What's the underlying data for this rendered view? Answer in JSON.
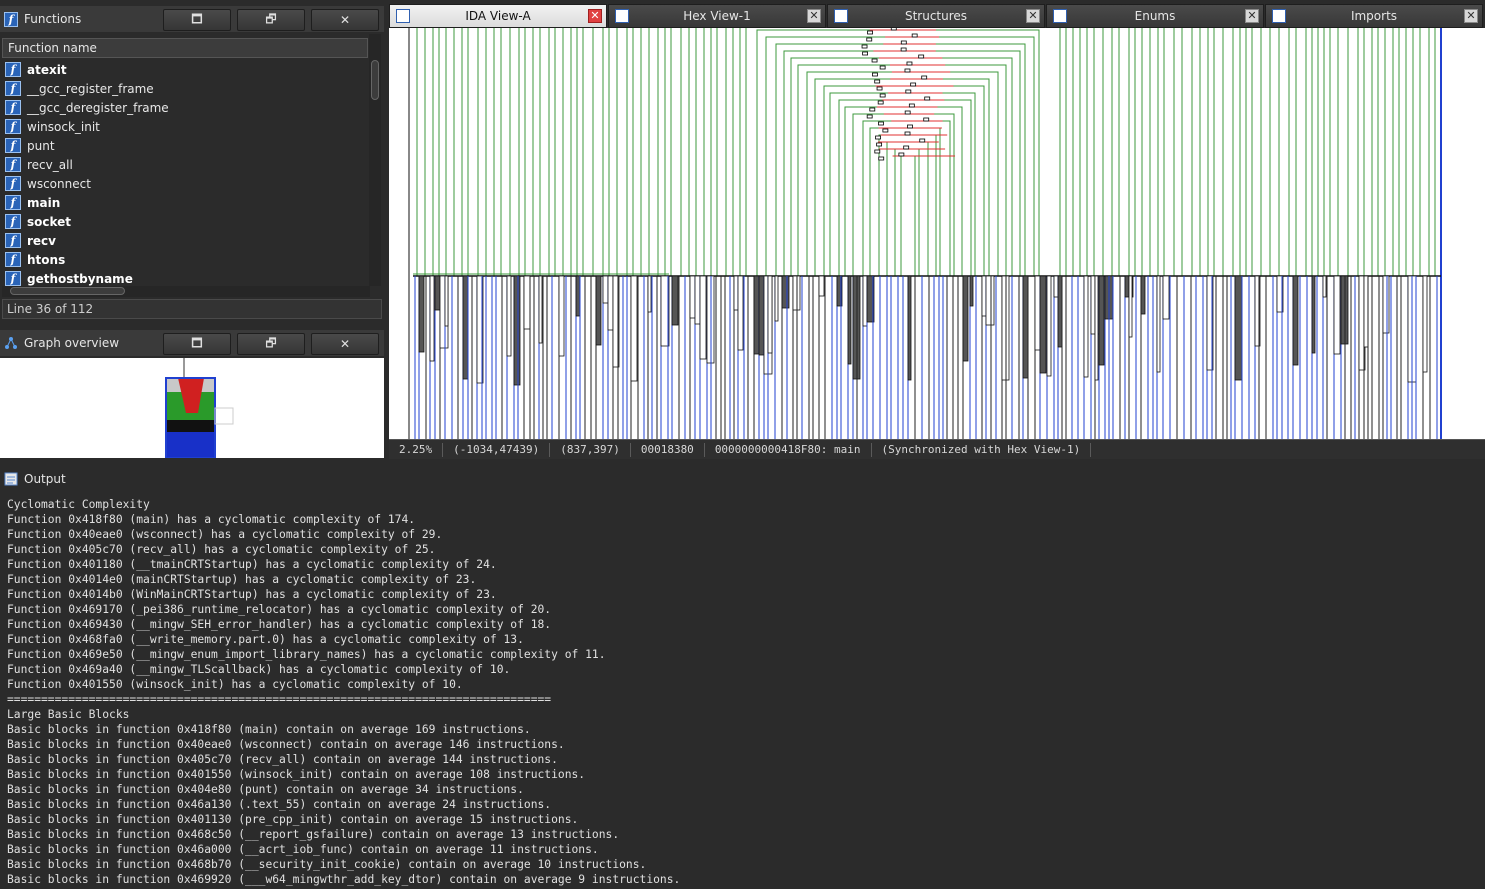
{
  "functions_panel": {
    "title": "Functions",
    "buttons": [
      "🗖",
      "🗗",
      "✕"
    ],
    "column_header": "Function name",
    "items": [
      {
        "name": "atexit",
        "bold": true
      },
      {
        "name": "__gcc_register_frame",
        "bold": false
      },
      {
        "name": "__gcc_deregister_frame",
        "bold": false
      },
      {
        "name": "winsock_init",
        "bold": false
      },
      {
        "name": "punt",
        "bold": false
      },
      {
        "name": "recv_all",
        "bold": false
      },
      {
        "name": "wsconnect",
        "bold": false
      },
      {
        "name": "main",
        "bold": true
      },
      {
        "name": "socket",
        "bold": true
      },
      {
        "name": "recv",
        "bold": true
      },
      {
        "name": "htons",
        "bold": true
      },
      {
        "name": "gethostbyname",
        "bold": true
      }
    ],
    "icon_glyph": "f",
    "status": "Line 36 of 112"
  },
  "overview_panel": {
    "title": "Graph overview",
    "buttons": [
      "🗖",
      "🗗",
      "✕"
    ]
  },
  "tabs": [
    {
      "label": "IDA View-A",
      "active": true
    },
    {
      "label": "Hex View-1",
      "active": false
    },
    {
      "label": "Structures",
      "active": false
    },
    {
      "label": "Enums",
      "active": false
    },
    {
      "label": "Imports",
      "active": false
    }
  ],
  "tab_close_glyph": "✕",
  "graph_status": {
    "zoom": "2.25%",
    "coords": "(-1034,47439)",
    "pos": "(837,397)",
    "offset": "00018380",
    "address": "0000000000418F80: main",
    "sync": "(Synchronized with Hex View-1)"
  },
  "output_panel": {
    "title": "Output",
    "lines": [
      "Cyclomatic Complexity",
      "Function 0x418f80 (main) has a cyclomatic complexity of 174.",
      "Function 0x40eae0 (wsconnect) has a cyclomatic complexity of 29.",
      "Function 0x405c70 (recv_all) has a cyclomatic complexity of 25.",
      "Function 0x401180 (__tmainCRTStartup) has a cyclomatic complexity of 24.",
      "Function 0x4014e0 (mainCRTStartup) has a cyclomatic complexity of 23.",
      "Function 0x4014b0 (WinMainCRTStartup) has a cyclomatic complexity of 23.",
      "Function 0x469170 (_pei386_runtime_relocator) has a cyclomatic complexity of 20.",
      "Function 0x469430 (__mingw_SEH_error_handler) has a cyclomatic complexity of 18.",
      "Function 0x468fa0 (__write_memory.part.0) has a cyclomatic complexity of 13.",
      "Function 0x469e50 (__mingw_enum_import_library_names) has a cyclomatic complexity of 11.",
      "Function 0x469a40 (__mingw_TLScallback) has a cyclomatic complexity of 10.",
      "Function 0x401550 (winsock_init) has a cyclomatic complexity of 10.",
      "================================================================================",
      "Large Basic Blocks",
      "Basic blocks in function 0x418f80 (main) contain on average 169 instructions.",
      "Basic blocks in function 0x40eae0 (wsconnect) contain on average 146 instructions.",
      "Basic blocks in function 0x405c70 (recv_all) contain on average 144 instructions.",
      "Basic blocks in function 0x401550 (winsock_init) contain on average 108 instructions.",
      "Basic blocks in function 0x404e80 (punt) contain on average 34 instructions.",
      "Basic blocks in function 0x46a130 (.text_55) contain on average 24 instructions.",
      "Basic blocks in function 0x401130 (pre_cpp_init) contain on average 15 instructions.",
      "Basic blocks in function 0x468c50 (__report_gsfailure) contain on average 13 instructions.",
      "Basic blocks in function 0x46a000 (__acrt_iob_func) contain on average 11 instructions.",
      "Basic blocks in function 0x468b70 (__security_init_cookie) contain on average 10 instructions.",
      "Basic blocks in function 0x469920 (___w64_mingwthr_add_key_dtor) contain on average 9 instructions."
    ]
  },
  "colors": {
    "edge_green": "#3c9a3c",
    "edge_red": "#e03030",
    "edge_blue": "#2040d0",
    "accent_blue": "#2a64b8"
  }
}
